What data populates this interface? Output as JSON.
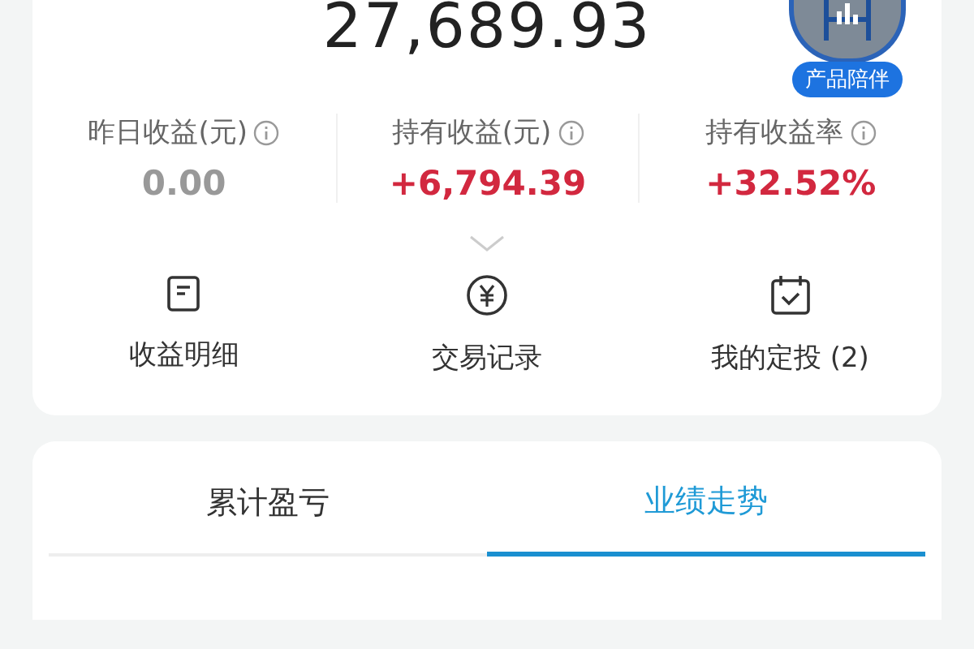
{
  "total_amount": "27,689.93",
  "badge": {
    "label": "产品陪伴"
  },
  "stats": [
    {
      "label": "昨日收益(元)",
      "value": "0.00",
      "color": "#999999"
    },
    {
      "label": "持有收益(元)",
      "value": "+6,794.39",
      "color": "#d2283f"
    },
    {
      "label": "持有收益率",
      "value": "+32.52%",
      "color": "#d2283f"
    }
  ],
  "actions": [
    {
      "kind": "document",
      "label": "收益明细"
    },
    {
      "kind": "yuan",
      "label": "交易记录"
    },
    {
      "kind": "calendar",
      "label": "我的定投 (2)"
    }
  ],
  "tabs": [
    {
      "label": "累计盈亏",
      "selected": false
    },
    {
      "label": "业绩走势",
      "selected": true
    }
  ]
}
